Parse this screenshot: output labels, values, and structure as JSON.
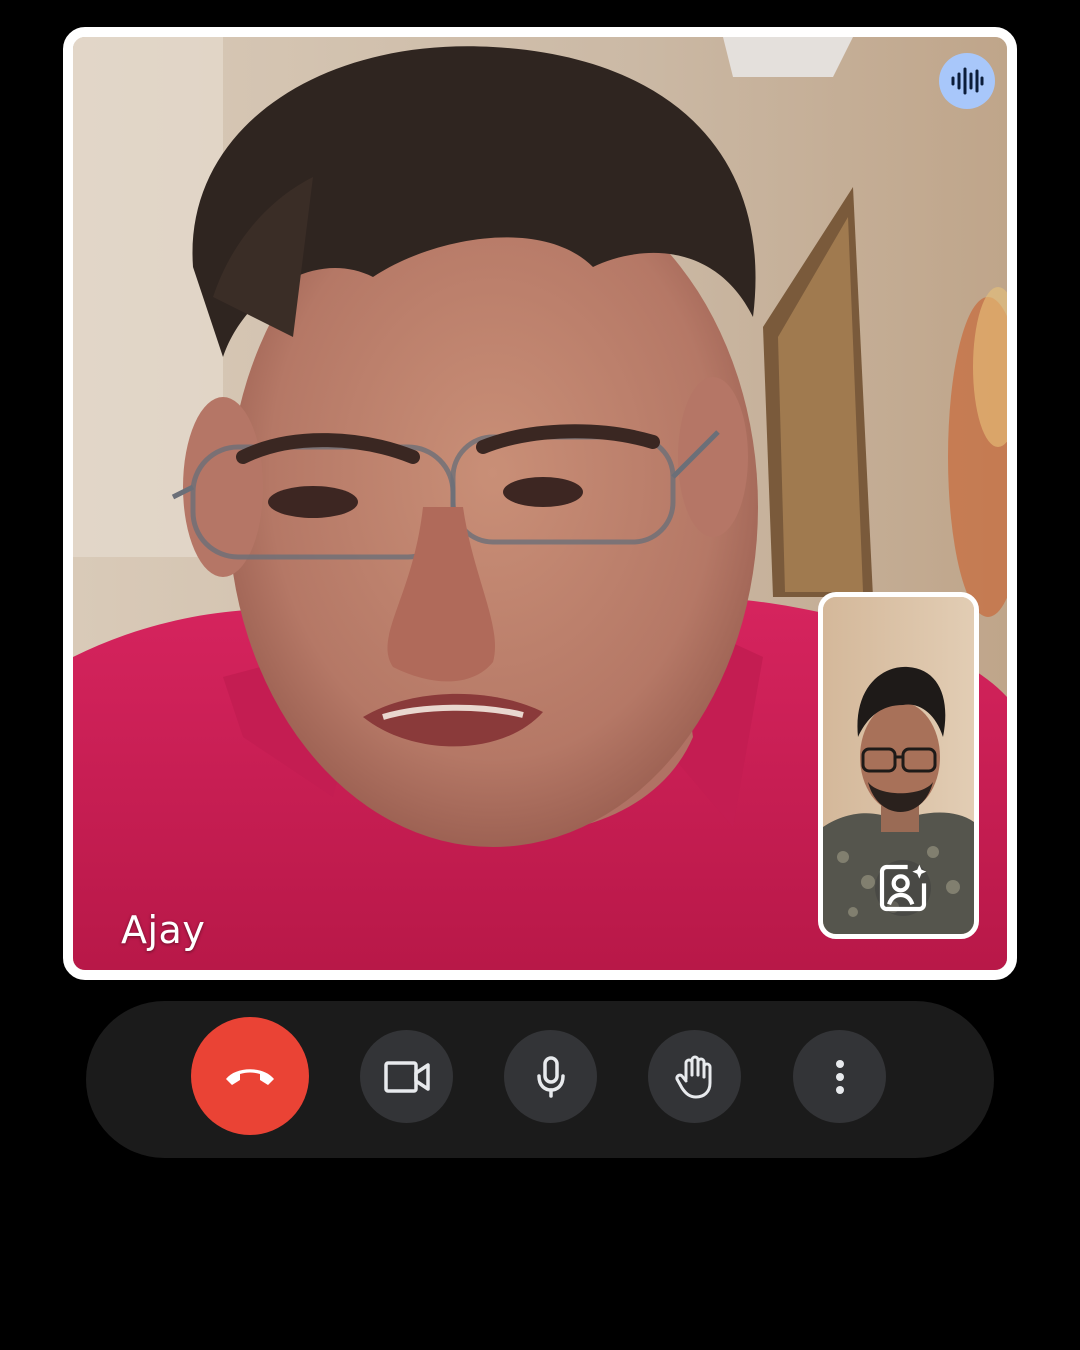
{
  "call": {
    "main_participant_name": "Ajay"
  },
  "icons": {
    "speaking": "audio-waveform-icon",
    "self_effects": "portrait-effects-icon",
    "end_call": "phone-hangup-icon",
    "camera": "videocam-icon",
    "microphone": "mic-icon",
    "raise_hand": "hand-icon",
    "more": "more-vertical-icon"
  },
  "colors": {
    "end_call": "#ea4335",
    "control_button": "#333437",
    "control_bar": "#1b1b1b",
    "speaking_badge": "#a8c7fa",
    "tile_border": "#ffffff"
  }
}
